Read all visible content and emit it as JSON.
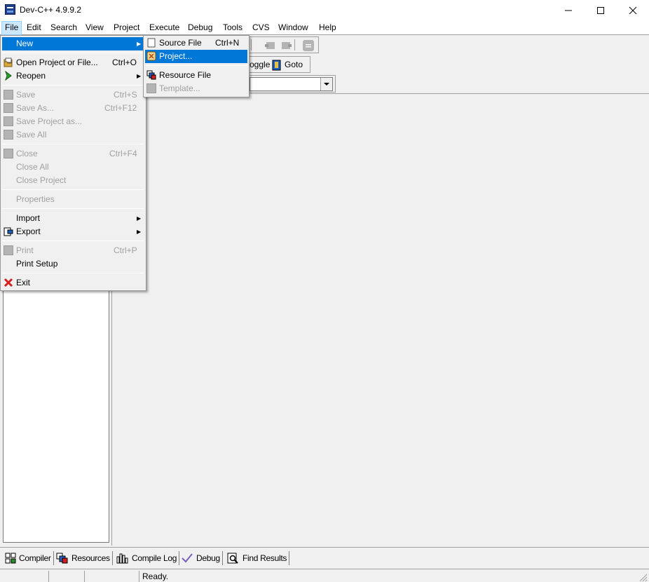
{
  "window": {
    "title": "Dev-C++ 4.9.9.2"
  },
  "menubar": [
    "File",
    "Edit",
    "Search",
    "View",
    "Project",
    "Execute",
    "Debug",
    "Tools",
    "CVS",
    "Window",
    "Help"
  ],
  "toolbar": {
    "toggle_label": "oggle",
    "goto_label": "Goto"
  },
  "file_menu": {
    "new": "New",
    "open": "Open Project or File...",
    "open_sc": "Ctrl+O",
    "reopen": "Reopen",
    "save": "Save",
    "save_sc": "Ctrl+S",
    "save_as": "Save As...",
    "save_as_sc": "Ctrl+F12",
    "save_project_as": "Save Project as...",
    "save_all": "Save All",
    "close": "Close",
    "close_sc": "Ctrl+F4",
    "close_all": "Close All",
    "close_project": "Close Project",
    "properties": "Properties",
    "import": "Import",
    "export": "Export",
    "print": "Print",
    "print_sc": "Ctrl+P",
    "print_setup": "Print Setup",
    "exit": "Exit"
  },
  "new_submenu": {
    "source_file": "Source File",
    "source_file_sc": "Ctrl+N",
    "project": "Project...",
    "resource_file": "Resource File",
    "template": "Template..."
  },
  "bottom_tabs": [
    "Compiler",
    "Resources",
    "Compile Log",
    "Debug",
    "Find Results"
  ],
  "status": {
    "text": "Ready."
  },
  "icons": {
    "app": "dev-cpp-icon",
    "open": "open-folder-icon",
    "reopen": "green-arrow-icon",
    "exit": "red-x-icon",
    "project": "project-icon",
    "resource": "resource-icon"
  },
  "colors": {
    "highlight": "#0078d7",
    "disabled_text": "#a0a0a0",
    "exit_red": "#d42020"
  }
}
